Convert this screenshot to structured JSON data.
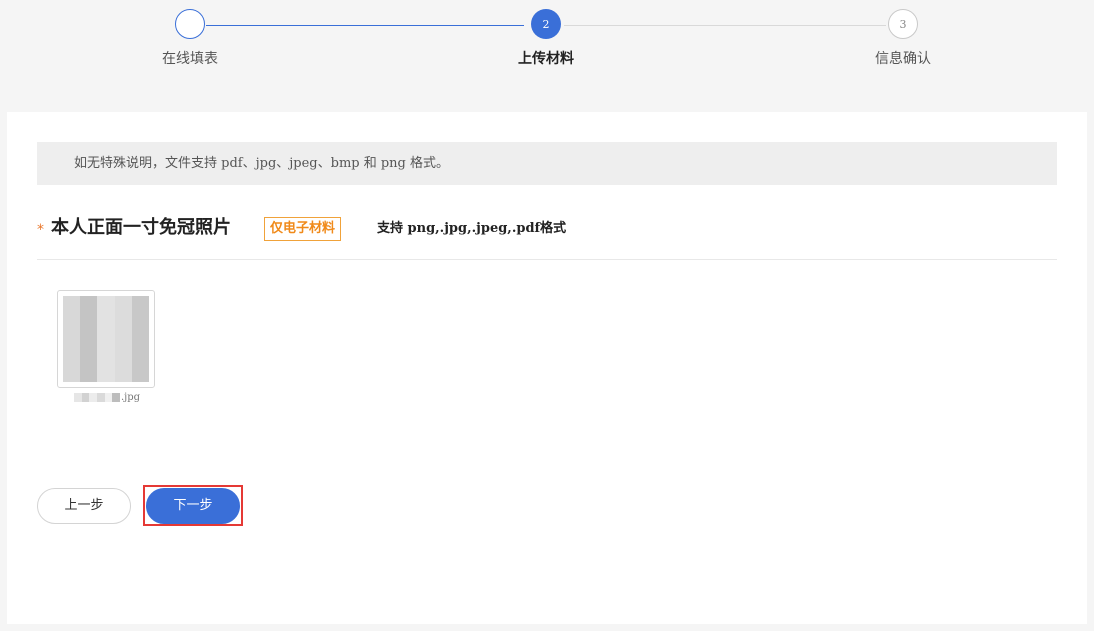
{
  "stepper": {
    "steps": [
      {
        "number": "",
        "label": "在线填表",
        "state": "done"
      },
      {
        "number": "2",
        "label": "上传材料",
        "state": "active"
      },
      {
        "number": "3",
        "label": "信息确认",
        "state": "pending"
      }
    ],
    "colors": {
      "active": "#3a6fd8",
      "pending": "#d9d9d9"
    }
  },
  "notice": {
    "text": "如无特殊说明，文件支持 pdf、jpg、jpeg、bmp 和 png 格式。"
  },
  "upload_item": {
    "required_mark": "*",
    "title": "本人正面一寸免冠照片",
    "tag": "仅电子材料",
    "formats": "支持 png,.jpg,.jpeg,.pdf格式",
    "files": [
      {
        "name_suffix": ".jpg",
        "name_blurred": true
      }
    ]
  },
  "buttons": {
    "prev_label": "上一步",
    "next_label": "下一步"
  },
  "colors": {
    "primary": "#3a6fd8",
    "tag": "#f08a1a",
    "highlight": "#e53935"
  }
}
